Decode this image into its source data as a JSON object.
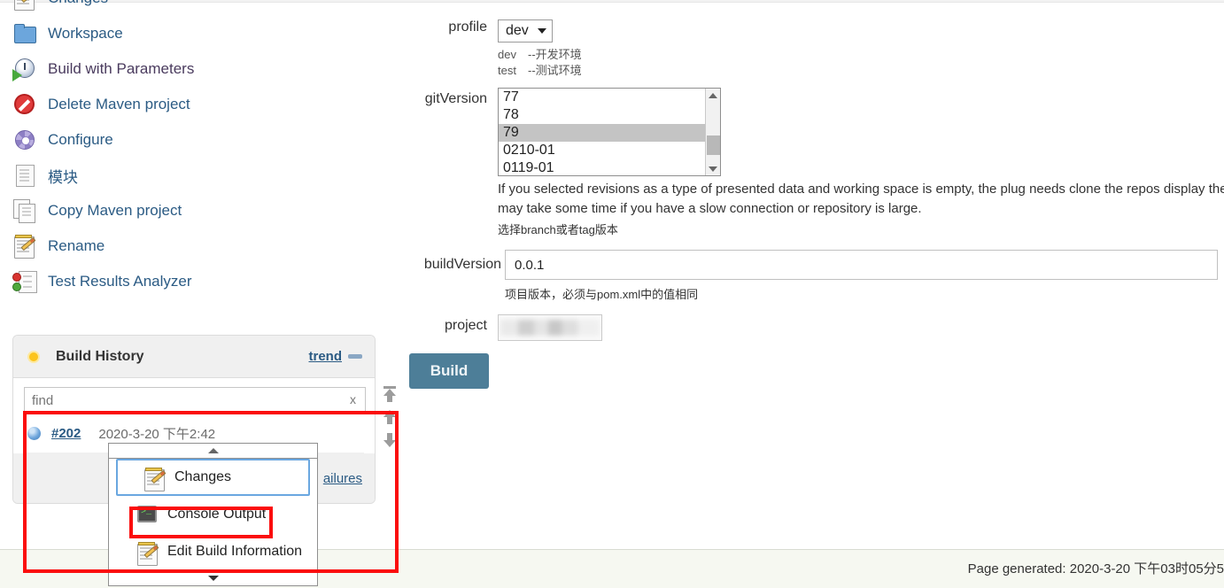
{
  "sidebar": {
    "items": [
      {
        "label": "Changes",
        "icon": "note-pencil-icon"
      },
      {
        "label": "Workspace",
        "icon": "folder-icon"
      },
      {
        "label": "Build with Parameters",
        "icon": "clock-play-icon"
      },
      {
        "label": "Delete Maven project",
        "icon": "deny-icon"
      },
      {
        "label": "Configure",
        "icon": "gear-icon"
      },
      {
        "label": "模块",
        "icon": "document-icon"
      },
      {
        "label": "Copy Maven project",
        "icon": "copy-icon"
      },
      {
        "label": "Rename",
        "icon": "note-pencil-icon"
      },
      {
        "label": "Test Results Analyzer",
        "icon": "test-results-icon"
      }
    ]
  },
  "build_history": {
    "title": "Build History",
    "trend_label": "trend",
    "find": {
      "value": "",
      "placeholder": "find",
      "clear_label": "x"
    },
    "rows": [
      {
        "number": "#202",
        "timestamp": "2020-3-20 下午2:42",
        "status": "blue"
      }
    ],
    "rss_link": "ailures",
    "scroll_buttons": [
      "scroll-to-top-icon",
      "scroll-up-icon",
      "scroll-down-icon"
    ]
  },
  "context_menu": {
    "items": [
      {
        "label": "Changes",
        "icon": "note-pencil-icon",
        "highlight": "blue"
      },
      {
        "label": "Console Output",
        "icon": "console-icon",
        "highlight": "red"
      },
      {
        "label": "Edit Build Information",
        "icon": "note-pencil-icon",
        "highlight": "none"
      }
    ]
  },
  "form": {
    "profile": {
      "label": "profile",
      "value": "dev",
      "options": [
        "dev",
        "test"
      ],
      "hints": [
        {
          "key": "dev",
          "text": "--开发环境"
        },
        {
          "key": "test",
          "text": "--测试环境"
        }
      ]
    },
    "gitVersion": {
      "label": "gitVersion",
      "options": [
        "77",
        "78",
        "79",
        "0210-01",
        "0119-01"
      ],
      "selected": "79",
      "help": "If you selected revisions as a type of presented data and working space is empty, the plug needs clone the repos display the contents. This may take some time if you have a slow connection or repository is large.",
      "cn_hint": "选择branch或者tag版本"
    },
    "buildVersion": {
      "label": "buildVersion",
      "value": "0.0.1",
      "cn_hint": "项目版本，必须与pom.xml中的值相同"
    },
    "project": {
      "label": "project",
      "value": ""
    },
    "build_button": "Build"
  },
  "footer": {
    "text": "Page generated: 2020-3-20 下午03时05分5"
  },
  "colors": {
    "link": "#2b5b84",
    "build_button": "#4d7e98",
    "annotation": "#fb0d0d",
    "selection": "#c4c4c4",
    "panel_header": "#f0f0f0",
    "footer_bg": "#f6f8f1"
  }
}
